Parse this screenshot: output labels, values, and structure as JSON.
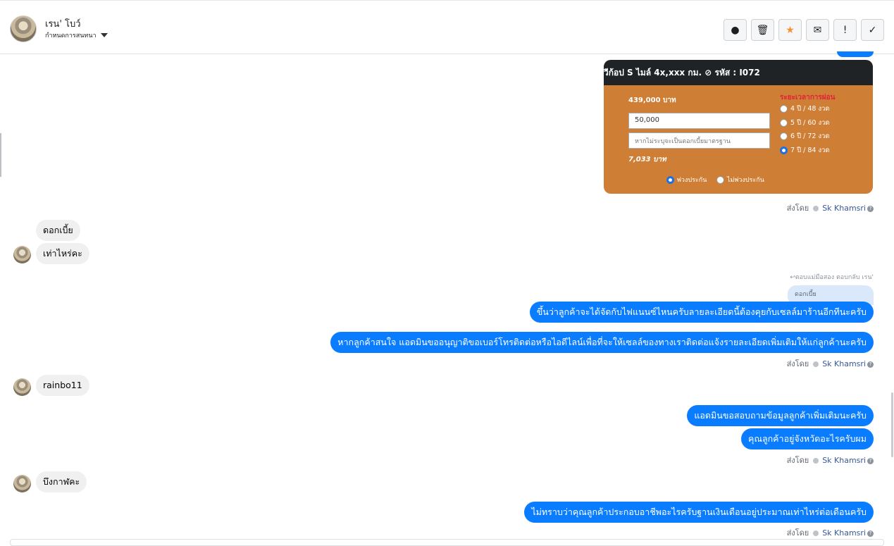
{
  "header": {
    "name": "เรน' โบว์",
    "subtitle": "กำหนดการสนทนา",
    "actions": [
      {
        "icon": "alert-circle-icon",
        "glyph": "●"
      },
      {
        "icon": "trash-icon",
        "glyph": "🗑"
      },
      {
        "icon": "star-icon",
        "glyph": "★"
      },
      {
        "icon": "mail-icon",
        "glyph": "✉"
      },
      {
        "icon": "exclamation-icon",
        "glyph": "!"
      },
      {
        "icon": "check-icon",
        "glyph": "✓"
      }
    ]
  },
  "card": {
    "title": "วีก้อป S ไมล์ 4x,xxx กม. ⊘ รหัส : I072",
    "price": "439,000 บาท",
    "down_payment": "50,000",
    "rate_placeholder": "หากไม่ระบุจะเป็นดอกเบี้ยมาตรฐาน",
    "monthly": "7,033 บาท",
    "plan_title": "ระยะเวลาการผ่อน",
    "plans": [
      {
        "label": "4 ปี / 48 งวด",
        "selected": false
      },
      {
        "label": "5 ปี / 60 งวด",
        "selected": false
      },
      {
        "label": "6 ปี / 72 งวด",
        "selected": false
      },
      {
        "label": "7 ปี / 84 งวด",
        "selected": true
      }
    ],
    "insurance": [
      {
        "label": "พ่วงประกัน",
        "selected": true
      },
      {
        "label": "ไม่พ่วงประกัน",
        "selected": false
      }
    ]
  },
  "sent_by_prefix": "ส่งโดย",
  "sent_by_name": "Sk Khamsri",
  "messages": {
    "in1": "ดอกเบี้ย",
    "in2": "เท่าไหร่คะ",
    "reply_note": "↩ตอบแม่มือสอง ตอบกลับ เรน'",
    "reply_quote": "ดอกเบี้ย",
    "out1": "ขึ้นว่าลูกค้าจะได้จัดกับไฟแนนซ์ไหนครับลายละเอียดนี้ต้องคุยกับเซลล์มาร้านอีกทีนะครับ",
    "out2": "หากลูกค้าสนใจ แอดมินขออนุญาติขอเบอร์โทรติดต่อหรือไอดีไลน์เพื่อที่จะให้เซลล์ของทางเราติดต่อแจ้งรายละเอียดเพิ่มเติมให้แก่ลูกค้านะครับ",
    "in3": "rainbo11",
    "out3": "แอดมินขอสอบถามข้อมูลลูกค้าเพิ่มเติมนะครับ",
    "out4": "คุณลูกค้าอยู่จังหวัดอะไรครับผม",
    "in4": "บึงกาฬคะ",
    "out5": "ไม่ทราบว่าคุณลูกค้าประกอบอาชีพอะไรครับฐานเงินเดือนอยู่ประมาณเท่าไหร่ต่อเดือนครับ"
  },
  "colors": {
    "outgoing": "#0a7cff",
    "incoming": "#f0f0f0",
    "card": "#cf7e35",
    "star": "#f7923a"
  }
}
